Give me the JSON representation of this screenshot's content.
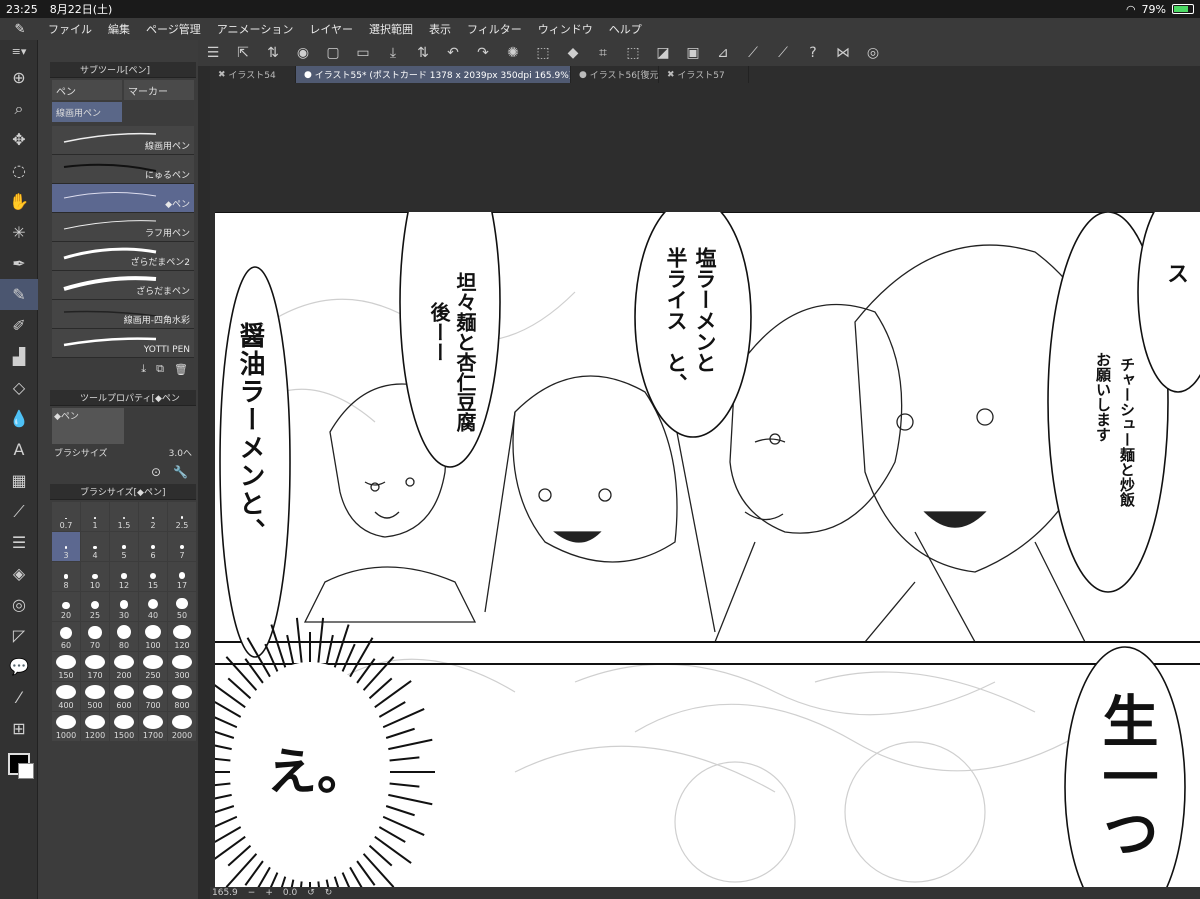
{
  "status": {
    "time": "23:25",
    "date": "8月22日(土)",
    "battery": "79%"
  },
  "menu": [
    "ファイル",
    "編集",
    "ページ管理",
    "アニメーション",
    "レイヤー",
    "選択範囲",
    "表示",
    "フィルター",
    "ウィンドウ",
    "ヘルプ"
  ],
  "subtool": {
    "title": "サブツール[ペン]",
    "tabs": [
      "ペン",
      "マーカー"
    ],
    "group": "線画用ペン",
    "brushes": [
      {
        "name": "線画用ペン"
      },
      {
        "name": "にゅるペン"
      },
      {
        "name": "◆ペン"
      },
      {
        "name": "ラフ用ペン"
      },
      {
        "name": "ざらだまペン2"
      },
      {
        "name": "ざらだまペン"
      },
      {
        "name": "線画用-四角水彩"
      },
      {
        "name": "YOTTI PEN"
      }
    ]
  },
  "toolprop": {
    "title": "ツールプロパティ[◆ペン",
    "preview_label": "◆ペン",
    "brush_size_label": "ブラシサイズ",
    "brush_size_value": "3.0へ"
  },
  "brushsize": {
    "title": "ブラシサイズ[◆ペン]",
    "sizes": [
      "0.7",
      "1",
      "1.5",
      "2",
      "2.5",
      "3",
      "4",
      "5",
      "6",
      "7",
      "8",
      "10",
      "12",
      "15",
      "17",
      "20",
      "25",
      "30",
      "40",
      "50",
      "60",
      "70",
      "80",
      "100",
      "120",
      "150",
      "170",
      "200",
      "250",
      "300",
      "400",
      "500",
      "600",
      "700",
      "800",
      "1000",
      "1200",
      "1500",
      "1700",
      "2000"
    ]
  },
  "doc_tabs": [
    "イラスト54",
    "イラスト55* (ポストカード 1378 x 2039px 350dpi 165.9%)",
    "イラスト56[復元]",
    "イラスト57"
  ],
  "bottom": {
    "zoom": "165.9",
    "angle": "0.0"
  },
  "manga": {
    "bubble1": "醤油ラーメンと、",
    "bubble2a": "坦々麺と杏仁豆腐",
    "bubble2b": "後ーー",
    "bubble3a": "塩ラーメンと",
    "bubble3b": "半ライス　と、",
    "bubble4a": "チャーシュー麺と炒飯",
    "bubble4b": "お願いします",
    "shout": "え。",
    "big": "生一つ",
    "topright": "ス"
  },
  "colors": {
    "accent": "#5c6890",
    "panel": "#3c3c3c"
  }
}
